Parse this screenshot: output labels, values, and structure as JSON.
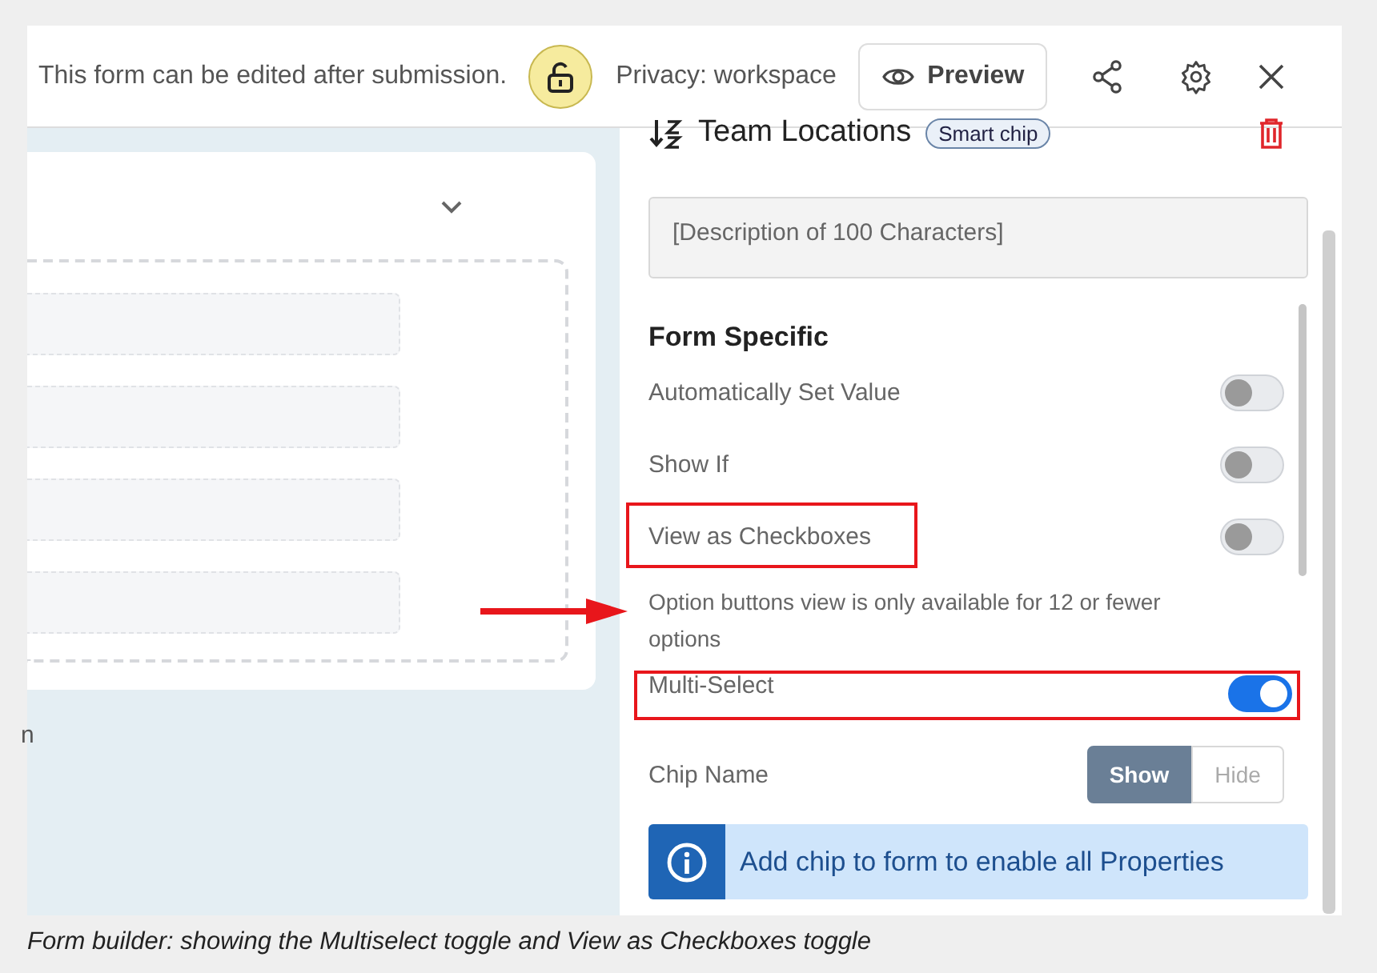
{
  "topbar": {
    "notice": "This form can be edited after submission.",
    "privacy": "Privacy: workspace",
    "preview_button": "Preview"
  },
  "canvas": {
    "cut_text": "n"
  },
  "field": {
    "title": "Team Locations",
    "chip": "Smart chip",
    "description_placeholder": "[Description of 100 Characters]"
  },
  "section": "Form Specific",
  "settings": [
    {
      "kind": "toggle",
      "label": "Automatically Set Value",
      "on": false,
      "label_highlighted": false,
      "row_highlighted": false
    },
    {
      "kind": "toggle",
      "label": "Show If",
      "on": false,
      "label_highlighted": false,
      "row_highlighted": false
    },
    {
      "kind": "toggle",
      "label": "View as Checkboxes",
      "on": false,
      "label_highlighted": true,
      "row_highlighted": false
    },
    {
      "kind": "note",
      "text": "Option buttons view is only available for 12 or fewer options"
    },
    {
      "kind": "toggle",
      "label": "Multi-Select",
      "on": true,
      "label_highlighted": false,
      "row_highlighted": true
    },
    {
      "kind": "segmented",
      "label": "Chip Name",
      "options": [
        {
          "label": "Show",
          "selected": true
        },
        {
          "label": "Hide",
          "selected": false
        }
      ]
    }
  ],
  "banner": "Add chip to form to enable all Properties",
  "caption": "Form builder: showing the Multiselect toggle and View as Checkboxes toggle"
}
